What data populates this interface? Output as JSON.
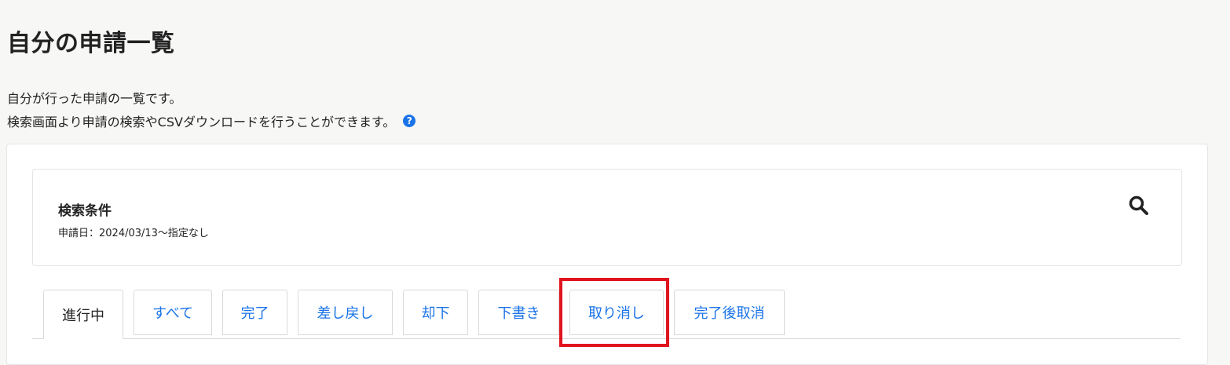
{
  "page": {
    "title": "自分の申請一覧",
    "description_line1": "自分が行った申請の一覧です。",
    "description_line2": "検索画面より申請の検索やCSVダウンロードを行うことができます。",
    "help_icon_glyph": "?"
  },
  "search": {
    "title": "検索条件",
    "condition": "申請日：2024/03/13～指定なし",
    "icon": "search-icon"
  },
  "tabs": [
    {
      "label": "進行中",
      "active": true
    },
    {
      "label": "すべて",
      "active": false
    },
    {
      "label": "完了",
      "active": false
    },
    {
      "label": "差し戻し",
      "active": false
    },
    {
      "label": "却下",
      "active": false
    },
    {
      "label": "下書き",
      "active": false
    },
    {
      "label": "取り消し",
      "active": false,
      "highlighted": true
    },
    {
      "label": "完了後取消",
      "active": false
    }
  ],
  "colors": {
    "link": "#1a73e8",
    "highlight": "#e0141e",
    "background": "#f7f7f5"
  }
}
